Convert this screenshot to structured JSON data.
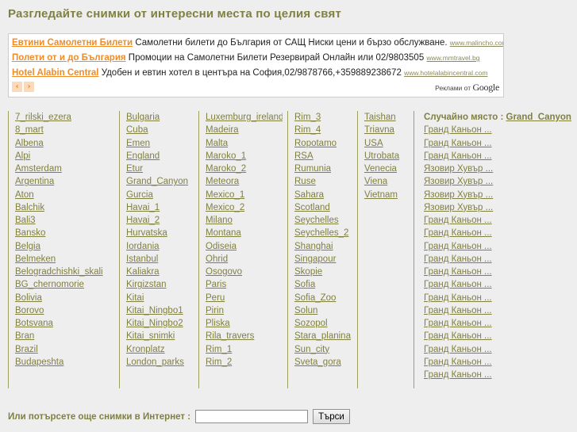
{
  "header": {
    "title": "Разгледайте снимки от интересни места по целия свят"
  },
  "ads": {
    "items": [
      {
        "title": "Евтини Самолетни Билети",
        "description": "Самолетни билети до България от САЩ Ниски цени и бързо обслужване.",
        "url": "www.malincho.com/"
      },
      {
        "title": "Полети от и до България",
        "description": "Промоции на Самолетни Билети Резервирай Онлайн или 02/9803505",
        "url": "www.mmtravel.bg"
      },
      {
        "title": "Hotel Alabin Central",
        "description": "Удобен и евтин хотел в центъра на София,02/9878766,+359889238672",
        "url": "www.hotelalabincentral.com"
      }
    ],
    "prev_label": "‹",
    "next_label": "›",
    "google_prefix": "Реклами от",
    "google_brand": "Google"
  },
  "columns": [
    {
      "items": [
        "7_rilski_ezera",
        "8_mart",
        "Albena",
        "Alpi",
        "Amsterdam",
        "Argentina",
        "Aton",
        "Balchik",
        "Bali3",
        "Bansko",
        "Belgia",
        "Belmeken",
        "Belogradchishki_skali",
        "BG_chernomorie",
        "Bolivia",
        "Borovo",
        "Botsvana",
        "Bran",
        "Brazil",
        "Budapeshta"
      ]
    },
    {
      "items": [
        "Bulgaria",
        "Cuba",
        "Emen",
        "England",
        "Etur",
        "Grand_Canyon",
        "Gurcia",
        "Havai_1",
        "Havai_2",
        "Hurvatska",
        "Iordania",
        "Istanbul",
        "Kaliakra",
        "Kirgizstan",
        "Kitai",
        "Kitai_Ningbo1",
        "Kitai_Ningbo2",
        "Kitai_snimki",
        "Kronplatz",
        "London_parks"
      ]
    },
    {
      "items": [
        "Luxemburg_ireland",
        "Madeira",
        "Malta",
        "Maroko_1",
        "Maroko_2",
        "Meteora",
        "Mexico_1",
        "Mexico_2",
        "Milano",
        "Montana",
        "Odiseia",
        "Ohrid",
        "Osogovo",
        "Paris",
        "Peru",
        "Pirin",
        "Pliska",
        "Rila_travers",
        "Rim_1",
        "Rim_2"
      ]
    },
    {
      "items": [
        "Rim_3",
        "Rim_4",
        "Ropotamo",
        "RSA",
        "Rumunia",
        "Ruse",
        "Sahara",
        "Scotland",
        "Seychelles",
        "Seychelles_2",
        "Shanghai",
        "Singapour",
        "Skopie",
        "Sofia",
        "Sofia_Zoo",
        "Solun",
        "Sozopol",
        "Stara_planina",
        "Sun_city",
        "Sveta_gora"
      ]
    },
    {
      "items": [
        "Taishan",
        "Triavna",
        "USA",
        "Utrobata",
        "Venecia",
        "Viena",
        "Vietnam"
      ]
    }
  ],
  "random_place": {
    "label": "Случайно място :",
    "value": "Grand_Canyon",
    "photos": [
      "Гранд Каньон ...",
      "Гранд Каньон ...",
      "Гранд Каньон ...",
      "Язовир Хувър ...",
      "Язовир Хувър ...",
      "Язовир Хувър ...",
      "Язовир Хувър ...",
      "Гранд Каньон ...",
      "Гранд Каньон ...",
      "Гранд Каньон ...",
      "Гранд Каньон ...",
      "Гранд Каньон ...",
      "Гранд Каньон ...",
      "Гранд Каньон ...",
      "Гранд Каньон ...",
      "Гранд Каньон ...",
      "Гранд Каньон ...",
      "Гранд Каньон ...",
      "Гранд Каньон ...",
      "Гранд Каньон ..."
    ]
  },
  "search": {
    "label": "Или потърсете още снимки в Интернет :",
    "value": "",
    "placeholder": "",
    "button_label": "Търси"
  },
  "colors": {
    "olive": "#808040",
    "ad_orange": "#f08c28",
    "page_bg": "#eeeeee",
    "rule": "#a0a060"
  }
}
